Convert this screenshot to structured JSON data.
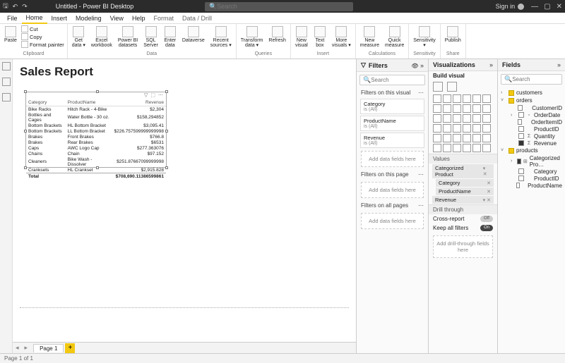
{
  "titlebar": {
    "title": "Untitled - Power BI Desktop",
    "search_placeholder": "Search",
    "signin": "Sign in",
    "win": {
      "min": "—",
      "max": "▢",
      "close": "✕"
    },
    "ql": {
      "save": "🖫",
      "undo": "↶",
      "redo": "↷"
    }
  },
  "menubar": {
    "tabs": [
      "File",
      "Home",
      "Insert",
      "Modeling",
      "View",
      "Help",
      "Format",
      "Data / Drill"
    ],
    "active": "Home"
  },
  "ribbon": {
    "clipboard": {
      "label": "Clipboard",
      "paste": "Paste",
      "cut": "Cut",
      "copy": "Copy",
      "fp": "Format painter"
    },
    "data": {
      "label": "Data",
      "items": [
        {
          "l": "Get\ndata ▾"
        },
        {
          "l": "Excel\nworkbook"
        },
        {
          "l": "Power BI\ndatasets"
        },
        {
          "l": "SQL\nServer"
        },
        {
          "l": "Enter\ndata"
        },
        {
          "l": "Dataverse"
        },
        {
          "l": "Recent\nsources ▾"
        }
      ]
    },
    "queries": {
      "label": "Queries",
      "items": [
        {
          "l": "Transform\ndata ▾"
        },
        {
          "l": "Refresh"
        }
      ]
    },
    "insert": {
      "label": "Insert",
      "items": [
        {
          "l": "New\nvisual"
        },
        {
          "l": "Text\nbox"
        },
        {
          "l": "More\nvisuals ▾"
        }
      ]
    },
    "calc": {
      "label": "Calculations",
      "items": [
        {
          "l": "New\nmeasure"
        },
        {
          "l": "Quick\nmeasure"
        }
      ]
    },
    "sens": {
      "label": "Sensitivity",
      "items": [
        {
          "l": "Sensitivity\n▾"
        }
      ]
    },
    "share": {
      "label": "Share",
      "items": [
        {
          "l": "Publish"
        }
      ]
    }
  },
  "report": {
    "title": "Sales Report",
    "headers": [
      "Category",
      "ProductName",
      "Revenue"
    ],
    "rows": [
      [
        "Bike Racks",
        "Hitch Rack - 4-Bike",
        "$2,304"
      ],
      [
        "Bottles and Cages",
        "Water Bottle - 30 oz.",
        "$158,294852"
      ],
      [
        "Bottom Brackets",
        "HL Bottom Bracket",
        "$3,095.41"
      ],
      [
        "Bottom Brackets",
        "LL Bottom Bracket",
        "$226.757599999999998"
      ],
      [
        "Brakes",
        "Front Brakes",
        "$766.8"
      ],
      [
        "Brakes",
        "Rear Brakes",
        "$6531"
      ],
      [
        "Caps",
        "AWC Logo Cap",
        "$277.363076"
      ],
      [
        "Chains",
        "Chain",
        "$97.152"
      ],
      [
        "Cleaners",
        "Bike Wash - Dissolver",
        "$251.87667099999998"
      ],
      [
        "Cranksets",
        "HL Crankset",
        "$2,915.828"
      ]
    ],
    "total": [
      "Total",
      "",
      "$708,690.11386599861"
    ]
  },
  "filters": {
    "title": "Filters",
    "search_placeholder": "Search",
    "on_visual": "Filters on this visual",
    "cards": [
      {
        "t": "Category",
        "s": "is (All)"
      },
      {
        "t": "ProductName",
        "s": "is (All)"
      },
      {
        "t": "Revenue",
        "s": "is (All)"
      }
    ],
    "add": "Add data fields here",
    "on_page": "Filters on this page",
    "on_all": "Filters on all pages"
  },
  "viz": {
    "title": "Visualizations",
    "build": "Build visual",
    "values": "Values",
    "wells": [
      {
        "t": "Categorized Product",
        "m": "▾ ✕"
      },
      {
        "t": "Category",
        "m": "✕",
        "nested": true
      },
      {
        "t": "ProductName",
        "m": "✕",
        "nested": true
      },
      {
        "t": "Revenue",
        "m": "▾ ✕"
      }
    ],
    "drill": "Drill through",
    "cross": "Cross-report",
    "keep": "Keep all filters",
    "add_drill": "Add drill-through fields here",
    "off": "Off",
    "on": "On"
  },
  "fields": {
    "title": "Fields",
    "search_placeholder": "Search",
    "tables": [
      {
        "name": "customers",
        "open": false,
        "fields": []
      },
      {
        "name": "orders",
        "open": true,
        "sel": true,
        "fields": [
          {
            "n": "CustomerID",
            "c": false,
            "s": ""
          },
          {
            "n": "OrderDate",
            "c": false,
            "s": "▫",
            "exp": true
          },
          {
            "n": "OrderItemID",
            "c": false,
            "s": ""
          },
          {
            "n": "ProductID",
            "c": false,
            "s": ""
          },
          {
            "n": "Quantity",
            "c": false,
            "s": "Σ"
          },
          {
            "n": "Revenue",
            "c": true,
            "s": "Σ"
          }
        ]
      },
      {
        "name": "products",
        "open": true,
        "sel": true,
        "fields": [
          {
            "n": "Categorized Pro…",
            "c": true,
            "s": "⊞",
            "exp": true
          },
          {
            "n": "Category",
            "c": false,
            "s": ""
          },
          {
            "n": "ProductID",
            "c": false,
            "s": ""
          },
          {
            "n": "ProductName",
            "c": false,
            "s": ""
          }
        ]
      }
    ]
  },
  "pages": {
    "tab": "Page 1",
    "status": "Page 1 of 1"
  }
}
